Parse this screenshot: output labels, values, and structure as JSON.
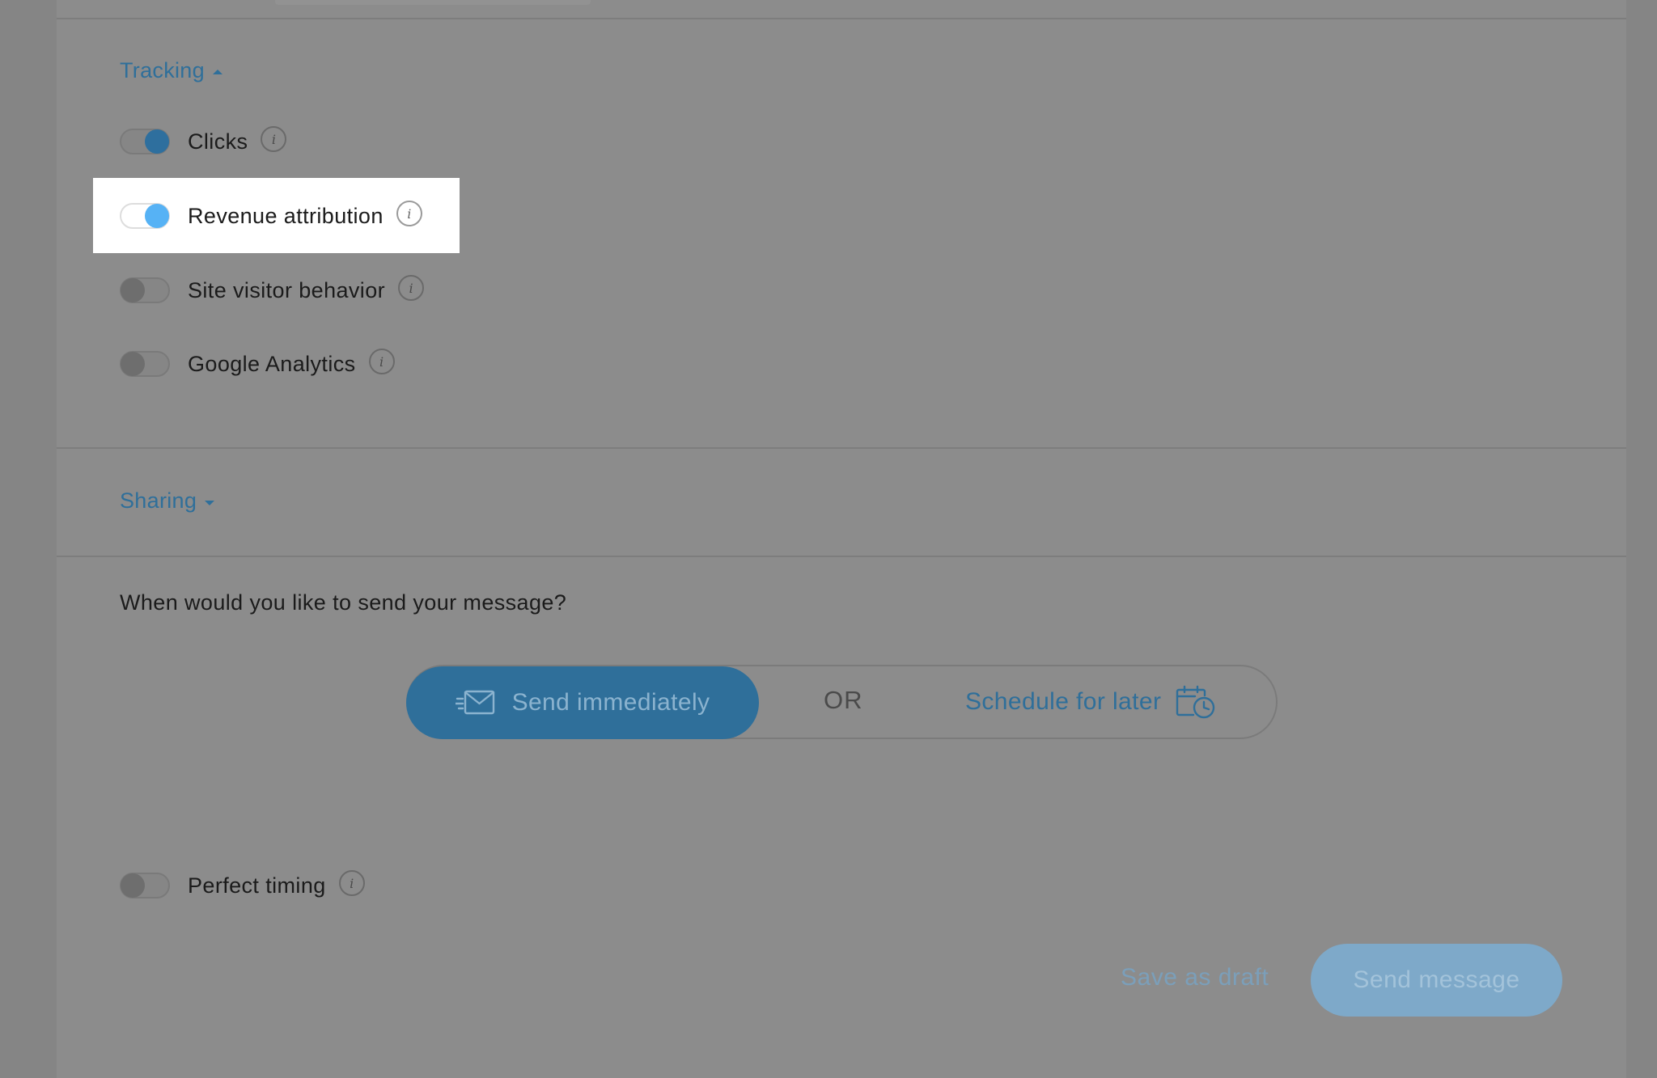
{
  "tracking": {
    "title": "Tracking",
    "items": [
      {
        "label": "Clicks",
        "state": "on"
      },
      {
        "label": "Revenue attribution",
        "state": "on"
      },
      {
        "label": "Site visitor behavior",
        "state": "off"
      },
      {
        "label": "Google Analytics",
        "state": "off"
      }
    ]
  },
  "sharing": {
    "title": "Sharing"
  },
  "schedule": {
    "question": "When would you like to send your message?",
    "send_now_label": "Send immediately",
    "or_label": "OR",
    "schedule_label": "Schedule for later"
  },
  "perfect_timing": {
    "label": "Perfect timing",
    "state": "off"
  },
  "footer": {
    "save_draft_label": "Save as draft",
    "send_label": "Send message"
  },
  "colors": {
    "accent": "#2f6f9a",
    "highlight_knob": "#56b2f5"
  },
  "icons": {
    "info": "info-icon",
    "send": "envelope-icon",
    "schedule": "calendar-clock-icon"
  }
}
